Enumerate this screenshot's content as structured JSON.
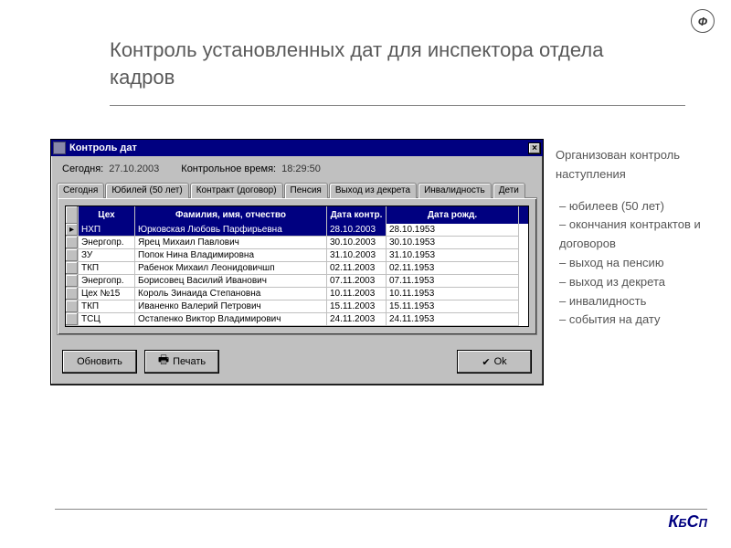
{
  "slide": {
    "title": "Контроль установленных дат для инспектора отдела кадров",
    "logo_letter": "Ф",
    "brand_K": "К",
    "brand_Б": "Б",
    "brand_C": "С",
    "brand_П": "П"
  },
  "side": {
    "intro": "Организован контроль наступления",
    "items": [
      "юбилеев (50 лет)",
      "окончания контрактов и договоров",
      "выход на пенсию",
      "выход из декрета",
      "инвалидность",
      "события на дату"
    ]
  },
  "window": {
    "title": "Контроль дат",
    "today_label": "Сегодня:",
    "today_value": "27.10.2003",
    "ctrl_time_label": "Контрольное время:",
    "ctrl_time_value": "18:29:50",
    "tabs": [
      "Сегодня",
      "Юбилей (50 лет)",
      "Контракт (договор)",
      "Пенсия",
      "Выход из декрета",
      "Инвалидность",
      "Дети"
    ],
    "active_tab": 1,
    "headers": {
      "dept": "Цех",
      "name": "Фамилия, имя, отчество",
      "dctrl": "Дата контр.",
      "dob": "Дата рожд."
    },
    "rows": [
      {
        "dept": "НХП",
        "name": "Юрковская Любовь Парфирьевна",
        "d1": "28.10.2003",
        "d2": "28.10.1953",
        "selected": true
      },
      {
        "dept": "Энергопр.",
        "name": "Ярец Михаил Павлович",
        "d1": "30.10.2003",
        "d2": "30.10.1953"
      },
      {
        "dept": "ЗУ",
        "name": "Попок Нина Владимировна",
        "d1": "31.10.2003",
        "d2": "31.10.1953"
      },
      {
        "dept": "ТКП",
        "name": "Рабенок Михаил Леонидовичшп",
        "d1": "02.11.2003",
        "d2": "02.11.1953"
      },
      {
        "dept": "Энергопр.",
        "name": "Борисовец Василий Иванович",
        "d1": "07.11.2003",
        "d2": "07.11.1953"
      },
      {
        "dept": "Цех №15",
        "name": "Король Зинаида Степановна",
        "d1": "10.11.2003",
        "d2": "10.11.1953"
      },
      {
        "dept": "ТКП",
        "name": "Иваненко Валерий Петрович",
        "d1": "15.11.2003",
        "d2": "15.11.1953"
      },
      {
        "dept": "ТСЦ",
        "name": "Остапенко Виктор Владимирович",
        "d1": "24.11.2003",
        "d2": "24.11.1953"
      }
    ],
    "buttons": {
      "refresh": "Обновить",
      "print": "Печать",
      "ok": "Ok"
    }
  }
}
